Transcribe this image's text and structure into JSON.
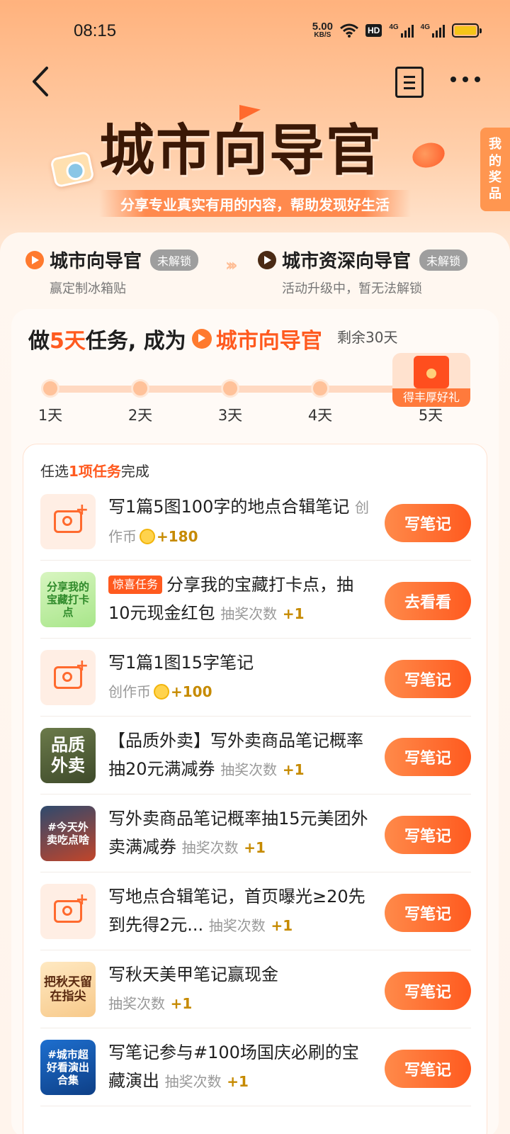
{
  "status_bar": {
    "time": "08:15",
    "net_speed_value": "5.00",
    "net_speed_unit": "KB/S",
    "hd_label": "HD",
    "sig1_label": "4G",
    "sig2_label": "4G"
  },
  "nav": {
    "back_icon": "back-arrow-icon",
    "doc_icon": "document-icon",
    "more_icon": "more-dots-icon"
  },
  "hero": {
    "title": "城市向导官",
    "subtitle": "分享专业真实有用的内容，帮助发现好生活"
  },
  "prize_tab": {
    "line1": "我",
    "line2": "的",
    "line3": "奖",
    "line4": "品"
  },
  "levels": [
    {
      "name": "城市向导官",
      "lock": "未解锁",
      "desc": "赢定制冰箱贴"
    },
    {
      "name": "城市资深向导官",
      "lock": "未解锁",
      "desc": "活动升级中，暂无法解锁"
    }
  ],
  "task_header": {
    "prefix": "做",
    "days_highlight": "5天",
    "middle": "任务, 成为",
    "target": "城市向导官",
    "remaining": "剩余30天"
  },
  "progress": {
    "days": [
      "1天",
      "2天",
      "3天",
      "4天",
      "5天"
    ],
    "gift_label": "得丰厚好礼"
  },
  "list_hint": {
    "prefix": "任选",
    "highlight": "1项任务",
    "suffix": "完成"
  },
  "tasks": [
    {
      "title": "写1篇5图100字的地点合辑笔记",
      "meta": "创作币",
      "bonus": "+180",
      "button": "写笔记"
    },
    {
      "tag": "惊喜任务",
      "title": "分享我的宝藏打卡点，抽10元现金红包",
      "meta": "抽奖次数",
      "bonus": "+1",
      "button": "去看看",
      "thumb_text": "分享我的宝藏打卡点"
    },
    {
      "title": "写1篇1图15字笔记",
      "meta": "创作币",
      "bonus": "+100",
      "button": "写笔记"
    },
    {
      "title": "【品质外卖】写外卖商品笔记概率抽20元满减券",
      "meta": "抽奖次数",
      "bonus": "+1",
      "button": "写笔记",
      "thumb_text": "品质外卖"
    },
    {
      "title": "写外卖商品笔记概率抽15元美团外卖满减券",
      "meta": "抽奖次数",
      "bonus": "+1",
      "button": "写笔记",
      "thumb_text": "#今天外卖吃点啥"
    },
    {
      "title": "写地点合辑笔记，首页曝光≥20先到先得2元...",
      "meta": "抽奖次数",
      "bonus": "+1",
      "button": "写笔记"
    },
    {
      "title": "写秋天美甲笔记赢现金",
      "meta": "抽奖次数",
      "bonus": "+1",
      "button": "写笔记",
      "thumb_text": "把秋天留在指尖"
    },
    {
      "title": "写笔记参与#100场国庆必刷的宝藏演出",
      "meta": "抽奖次数",
      "bonus": "+1",
      "button": "写笔记",
      "thumb_text": "#城市超好看演出合集"
    }
  ],
  "colors": {
    "accent": "#ff5a1f",
    "bonus": "#c68a00",
    "lock_badge": "#9e9e9e"
  }
}
